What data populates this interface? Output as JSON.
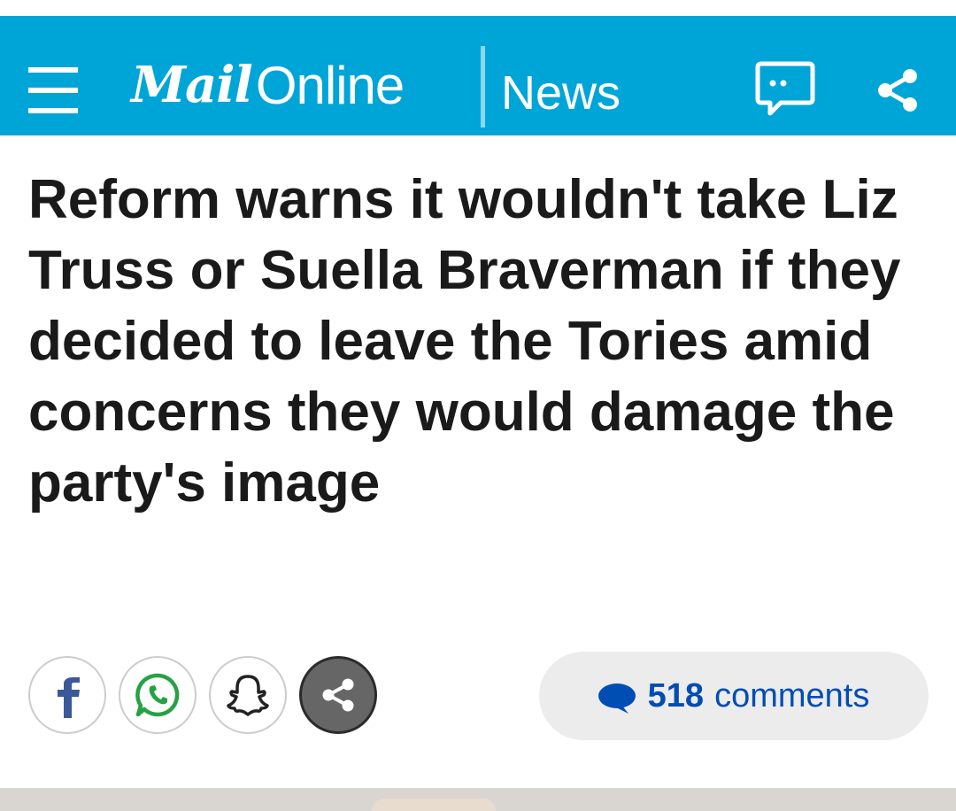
{
  "header": {
    "logo_mail": "Mail",
    "logo_online": "Online",
    "section": "News",
    "colors": {
      "background": "#00a5d8",
      "foreground": "#ffffff"
    },
    "icons": {
      "menu": "hamburger-menu-icon",
      "comments": "comment-bubble-icon",
      "share": "share-icon"
    }
  },
  "article": {
    "headline": "Reform warns it wouldn't take Liz Truss or Suella Braverman if they decided to leave the Tories amid concerns they would damage the party's image"
  },
  "social": {
    "buttons": [
      {
        "name": "facebook",
        "icon": "facebook-icon",
        "color": "#3b5998"
      },
      {
        "name": "whatsapp",
        "icon": "whatsapp-icon",
        "color": "#25a244"
      },
      {
        "name": "snapchat",
        "icon": "snapchat-icon",
        "color": "#222222"
      },
      {
        "name": "share",
        "icon": "share-icon",
        "color": "#666666"
      }
    ]
  },
  "comments": {
    "count": "518",
    "label": "comments",
    "color": "#004db3",
    "icon": "speech-bubble-icon"
  }
}
